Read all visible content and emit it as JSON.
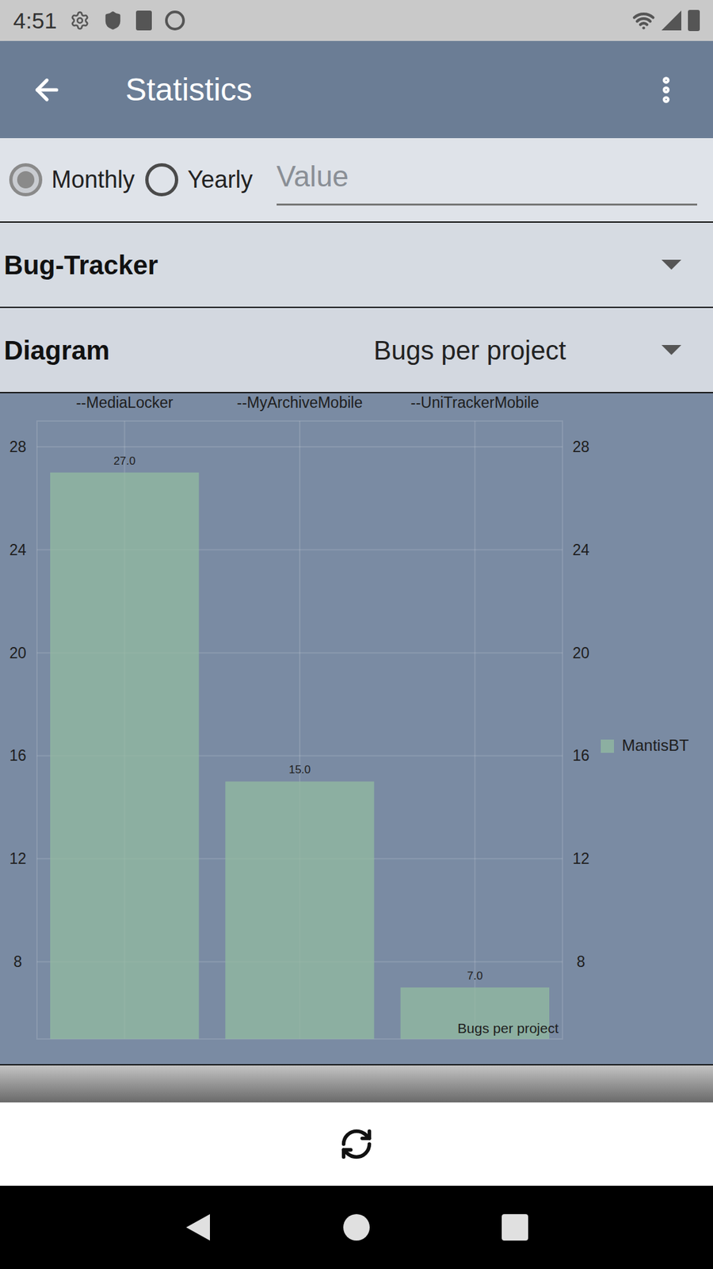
{
  "status_bar": {
    "time": "4:51"
  },
  "toolbar": {
    "title": "Statistics"
  },
  "period_options": [
    {
      "label": "Monthly",
      "selected": true
    },
    {
      "label": "Yearly",
      "selected": false
    }
  ],
  "value_field": {
    "placeholder": "Value",
    "value": ""
  },
  "bug_tracker": {
    "label": "Bug-Tracker",
    "value": ""
  },
  "diagram": {
    "label": "Diagram",
    "value": "Bugs per project"
  },
  "chart": {
    "categories": [
      "--MediaLocker",
      "--MyArchiveMobile",
      "--UniTrackerMobile"
    ],
    "series": [
      {
        "name": "MantisBT",
        "values": [
          27,
          15,
          7
        ],
        "value_labels": [
          "27.0",
          "15.0",
          "7.0"
        ],
        "color": "#93bba0"
      }
    ],
    "y_ticks": [
      "8",
      "12",
      "16",
      "20",
      "24",
      "28"
    ],
    "description": "Bugs per project"
  }
}
